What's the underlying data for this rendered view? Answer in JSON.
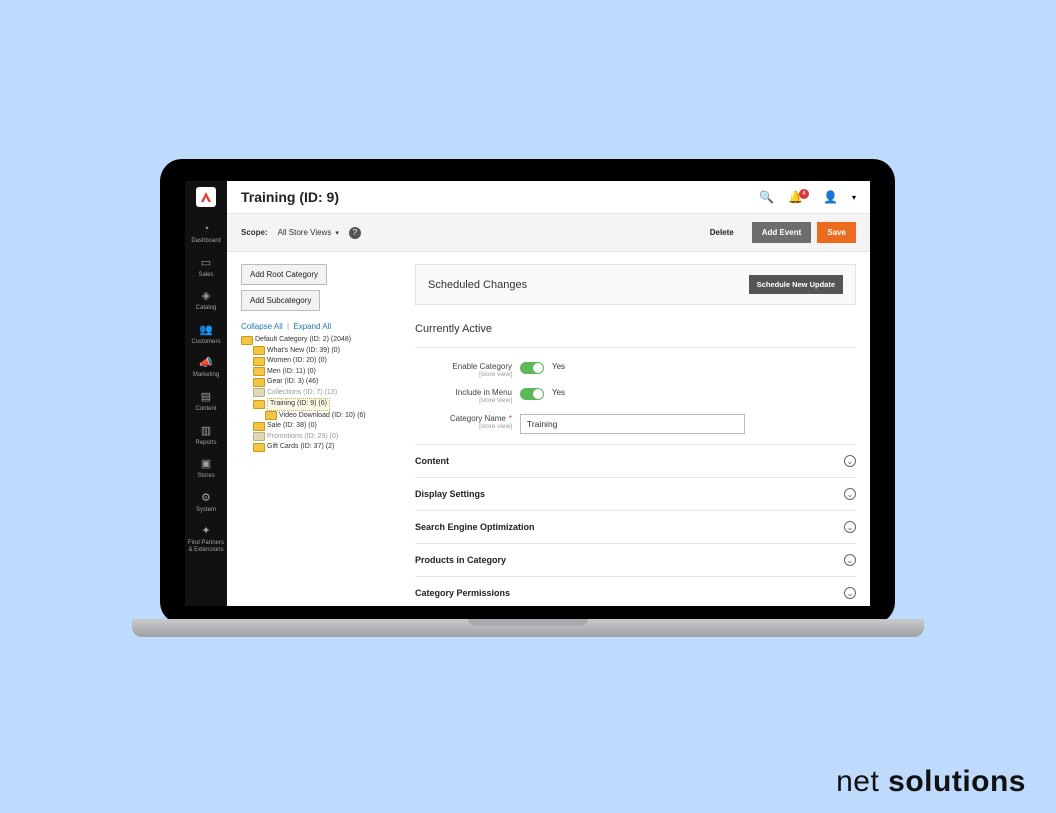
{
  "page_title": "Training (ID: 9)",
  "notification_count": "4",
  "sidebar": {
    "items": [
      {
        "label": "Dashboard"
      },
      {
        "label": "Sales"
      },
      {
        "label": "Catalog"
      },
      {
        "label": "Customers"
      },
      {
        "label": "Marketing"
      },
      {
        "label": "Content"
      },
      {
        "label": "Reports"
      },
      {
        "label": "Stores"
      },
      {
        "label": "System"
      },
      {
        "label": "Find Partners\n& Extensions"
      }
    ]
  },
  "scope": {
    "label": "Scope:",
    "value": "All Store Views"
  },
  "actions": {
    "delete": "Delete",
    "add_event": "Add Event",
    "save": "Save",
    "add_root": "Add Root Category",
    "add_sub": "Add Subcategory",
    "collapse_all": "Collapse All",
    "expand_all": "Expand All",
    "schedule_new": "Schedule New Update"
  },
  "tree": [
    {
      "label": "Default Category (ID: 2) (2048)",
      "indent": 0,
      "muted": false
    },
    {
      "label": "What's New (ID: 39) (0)",
      "indent": 1,
      "muted": false
    },
    {
      "label": "Women (ID: 20) (0)",
      "indent": 1,
      "muted": false
    },
    {
      "label": "Men (ID: 11) (0)",
      "indent": 1,
      "muted": false
    },
    {
      "label": "Gear (ID: 3) (46)",
      "indent": 1,
      "muted": false
    },
    {
      "label": "Collections (ID: 7) (13)",
      "indent": 1,
      "muted": true
    },
    {
      "label": "Training (ID: 9) (6)",
      "indent": 1,
      "muted": false,
      "highlight": true
    },
    {
      "label": "Video Download (ID: 10) (6)",
      "indent": 2,
      "muted": false
    },
    {
      "label": "Sale (ID: 38) (0)",
      "indent": 1,
      "muted": false
    },
    {
      "label": "Promotions (ID: 29) (0)",
      "indent": 1,
      "muted": true
    },
    {
      "label": "Gift Cards (ID: 37) (2)",
      "indent": 1,
      "muted": false
    }
  ],
  "scheduled": {
    "title": "Scheduled Changes"
  },
  "active": {
    "title": "Currently Active",
    "enable_label": "Enable Category",
    "enable_scope": "[store view]",
    "enable_value": "Yes",
    "include_label": "Include in Menu",
    "include_scope": "[store view]",
    "include_value": "Yes",
    "name_label": "Category Name",
    "name_scope": "[store view]",
    "name_value": "Training"
  },
  "sections": [
    "Content",
    "Display Settings",
    "Search Engine Optimization",
    "Products in Category",
    "Category Permissions"
  ],
  "brand": {
    "part1": "net ",
    "part2": "solutions"
  }
}
